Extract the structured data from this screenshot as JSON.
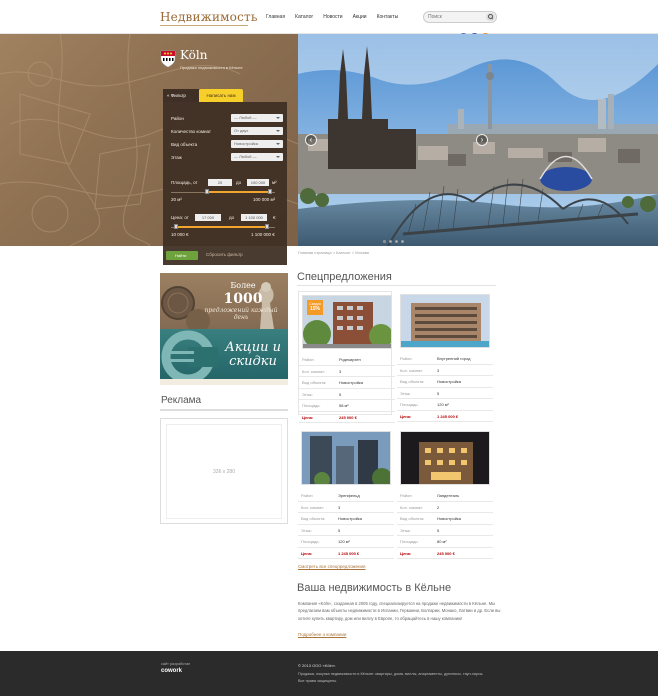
{
  "header": {
    "logo": "Недвижимость",
    "nav": [
      "Главная",
      "Каталог",
      "Новости",
      "Акции",
      "Контакты"
    ],
    "search_placeholder": "Поиск"
  },
  "social": [
    {
      "name": "vk",
      "label": "В",
      "color": "#4c75a3"
    },
    {
      "name": "facebook",
      "label": "f",
      "color": "#3b5998"
    },
    {
      "name": "odnoklassniki",
      "label": "О",
      "color": "#ef8d1f"
    }
  ],
  "city": {
    "name": "Köln",
    "subtitle": "Продажа недвижимости в Кёльне"
  },
  "filter": {
    "tab_filter": "Фильтр",
    "tab_find": "Написать нам",
    "fields": [
      {
        "label": "Район",
        "value": "— Любой —"
      },
      {
        "label": "Количество комнат",
        "value": "От двух"
      },
      {
        "label": "Вид объекта",
        "value": "Новостройка"
      },
      {
        "label": "Этаж",
        "value": "— Любой —"
      }
    ],
    "area": {
      "label": "Площадь, от",
      "from": "20",
      "to_label": "до",
      "to": "100 000",
      "unit": "м²",
      "min_label": "20 м²",
      "max_label": "100 000 м²",
      "low": 0.35,
      "high": 0.95
    },
    "price": {
      "label": "Цена: от",
      "from": "17 000",
      "to_label": "до",
      "to": "1 100 000",
      "unit": "€",
      "min_label": "10 000 €",
      "max_label": "1 100 000 €",
      "low": 0.05,
      "high": 0.92
    },
    "find_button": "Найти",
    "reset_link": "Сбросить фильтр"
  },
  "slider": {
    "dots": 4,
    "active": 0
  },
  "breadcrumb": "Главная страница > Каталог > Москва",
  "promos": {
    "p1_line1": "Более",
    "p1_line2": "1000",
    "p1_line3": "предложений каждый день",
    "p2_text": "Акции и скидки"
  },
  "sidebar": {
    "ad_title": "Реклама",
    "ad_size": "336 x 280"
  },
  "special": {
    "title": "Спецпредложения",
    "badge_top": "Скидка",
    "badge_value": "15%",
    "labels": {
      "district": "Район:",
      "rooms": "Кол. комнат:",
      "type": "Вид объекта:",
      "floor": "Этаж:",
      "area": "Площадь:",
      "price": "Цена:"
    },
    "cards": [
      {
        "district": "Родекирхен",
        "rooms": "3",
        "type": "Новостройка",
        "floor": "5",
        "area": "58 м²",
        "price": "245 000 €"
      },
      {
        "district": "Внутренний город",
        "rooms": "3",
        "type": "Новостройка",
        "floor": "5",
        "area": "120 м²",
        "price": "1 245 000 €"
      },
      {
        "district": "Эренфельд",
        "rooms": "3",
        "type": "Новостройка",
        "floor": "5",
        "area": "120 м²",
        "price": "1 245 000 €"
      },
      {
        "district": "Ланденталь",
        "rooms": "2",
        "type": "Новостройка",
        "floor": "5",
        "area": "80 м²",
        "price": "245 000 €"
      }
    ],
    "all_link": "Смотреть все спецпредложения"
  },
  "about": {
    "title": "Ваша недвижимость в Кёльне",
    "text": "Компания «Köln», созданная в 2005 году, специализируется на продаже недвижимости в Кёльне. Мы предлагаем вам объекты недвижимости в Испании, Германии, Болгарии, Монако, Латвии и др. Если вы хотите купить квартиру, дом или виллу в Европе, то обращайтесь в нашу компанию!",
    "more": "Подробнее о компании"
  },
  "footer": {
    "made_by": "сайт разработан",
    "brand": "cowork",
    "copyright": "© 2013 ООО «Köln».",
    "desc1": "Продажа, покупка недвижимости в Кёльне: квартиры, дома, виллы, апартаменты, дуплексы, таун-хаусы.",
    "desc2": "Все права защищены."
  }
}
